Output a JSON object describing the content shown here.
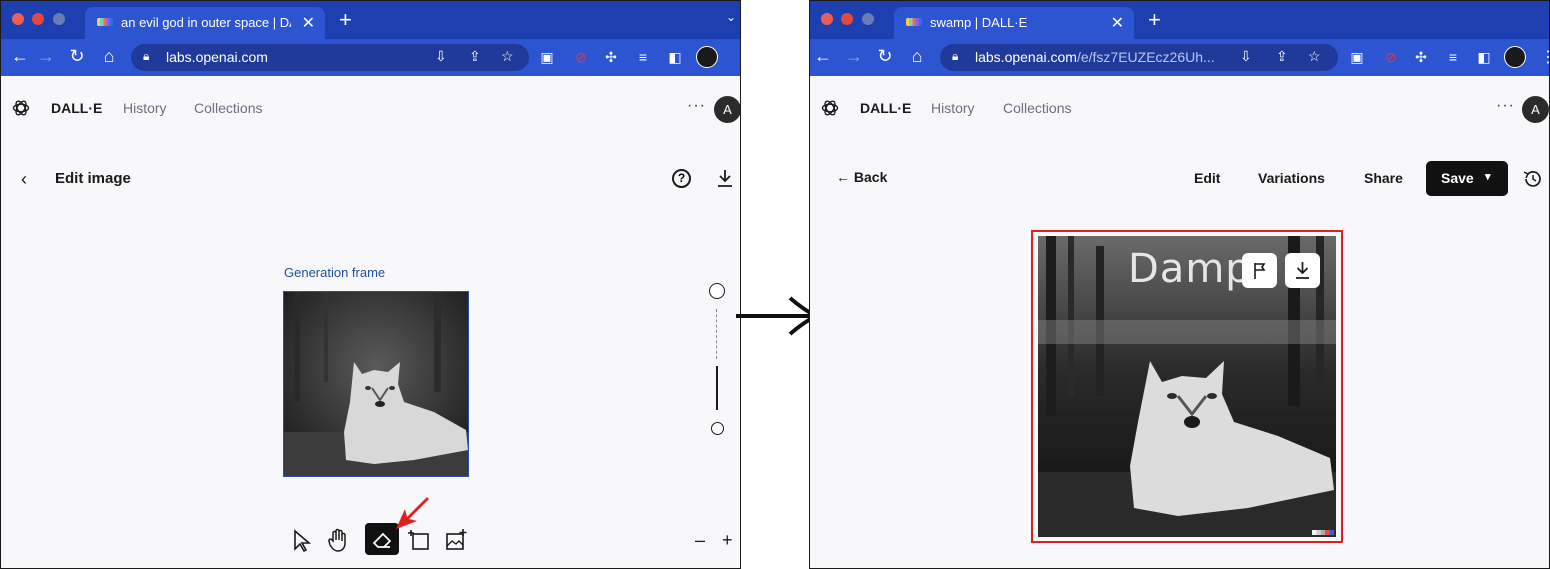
{
  "left_window": {
    "tab_title": "an evil god in outer space | DALL·E",
    "url": "labs.openai.com",
    "url_path": "",
    "nav": {
      "brand": "DALL·E",
      "history": "History",
      "collections": "Collections",
      "avatar_initial": "A"
    },
    "editor": {
      "title": "Edit image",
      "generation_frame_label": "Generation frame",
      "tools": [
        "select-tool",
        "hand-tool",
        "eraser-tool",
        "add-generation-frame-tool",
        "upload-image-tool"
      ],
      "active_tool": "eraser-tool",
      "zoom_out": "–",
      "zoom_in": "+"
    }
  },
  "right_window": {
    "tab_title": "swamp | DALL·E",
    "url": "labs.openai.com",
    "url_path": "/e/fsz7EUZEcz26Uh...",
    "nav": {
      "brand": "DALL·E",
      "history": "History",
      "collections": "Collections",
      "avatar_initial": "A"
    },
    "actions": {
      "back": "Back",
      "edit": "Edit",
      "variations": "Variations",
      "share": "Share",
      "save": "Save"
    },
    "image_overlay_text": "Dampr"
  },
  "colors": {
    "browser_chrome": "#2d54d1",
    "highlight_border": "#e02020",
    "annotation_arrow": "#e02020"
  },
  "icons": [
    "lock-icon",
    "back-arrow-icon",
    "forward-arrow-icon",
    "reload-icon",
    "home-icon",
    "bookmark-star-icon",
    "extension-puzzle-icon",
    "help-icon",
    "download-icon",
    "flag-icon",
    "history-icon",
    "openai-logo-icon"
  ]
}
